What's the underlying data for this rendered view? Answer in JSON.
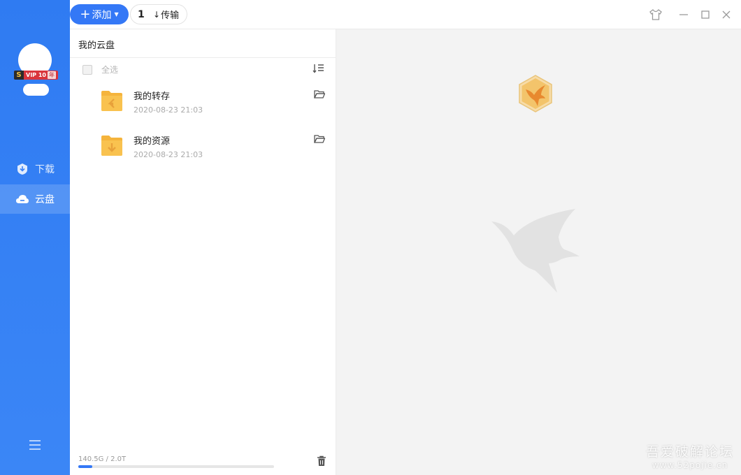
{
  "sidebar": {
    "vip": {
      "s": "S",
      "label": "VIP 10",
      "year": "年"
    },
    "nav": [
      {
        "label": "下载",
        "icon": "download-shield-icon"
      },
      {
        "label": "云盘",
        "icon": "cloud-icon"
      }
    ],
    "menu_icon": "hamburger-menu-icon",
    "accent": "#3478f6"
  },
  "topbar": {
    "add_label": "添加",
    "transfer_count": "1",
    "transfer_label": "传输",
    "icons": [
      "skin-shirt-icon",
      "minimize-icon",
      "maximize-icon",
      "close-icon"
    ]
  },
  "panel": {
    "title": "我的云盘",
    "select_all": "全选",
    "files": [
      {
        "name": "我的转存",
        "date": "2020-08-23 21:03"
      },
      {
        "name": "我的资源",
        "date": "2020-08-23 21:03"
      }
    ],
    "storage_text": "140.5G / 2.0T",
    "storage_used_fraction": 0.07
  },
  "watermark": {
    "cn": "吾爱破解论坛",
    "url": "www.52pojie.cn"
  }
}
